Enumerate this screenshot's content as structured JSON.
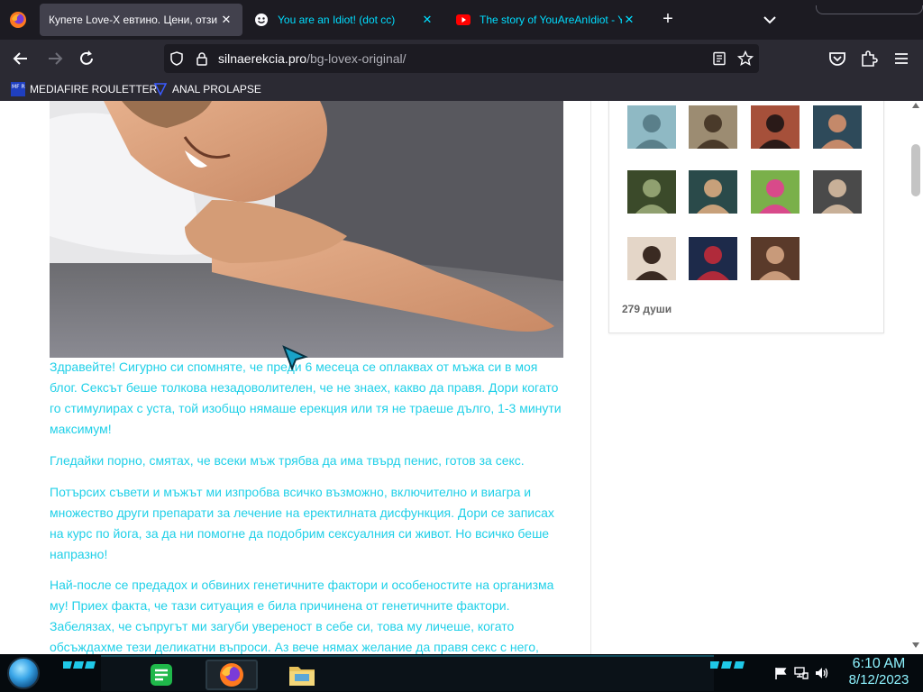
{
  "browser": {
    "tabs": [
      {
        "title": "Купете Love-X евтино. Цени, отзи",
        "active": true
      },
      {
        "title": "You are an Idiot! (dot cc)",
        "active": false
      },
      {
        "title": "The story of YouAreAnIdiot - Yo",
        "active": false
      }
    ],
    "url": {
      "domain": "silnaerekcia.pro",
      "path": "/bg-lovex-original/"
    },
    "bookmarks": [
      {
        "label": "MEDIAFIRE ROULETTER",
        "icon_text": "MF R"
      },
      {
        "label": "ANAL PROLAPSE"
      }
    ]
  },
  "article": {
    "paragraphs": [
      "Здравейте! Сигурно си спомняте, че преди 6 месеца се оплаквах от мъжа си в моя блог. Сексът беше толкова незадоволителен, че не знаех, какво да правя. Дори когато го стимулирах с уста, той изобщо нямаше ерекция или тя не траеше дълго, 1-3 минути максимум!",
      "Гледайки порно, смятах, че всеки мъж трябва да има твърд пенис, готов за секс.",
      "Потърсих съвети и мъжът ми изпробва всичко възможно, включително и виагра и множество други препарати за лечение на еректилната дисфункция. Дори се записах на курс по йога, за да ни помогне да подобрим сексуалния си живот. Но всичко беше напразно!",
      "Най-после се предадох и обвиних генетичните фактори и особеностите на организма му! Приех факта, че тази ситуация е била причинена от генетичните фактори. Забелязах, че съпругът ми загуби увереност в себе си, това му личеше, когато обсъждахме тези деликатни въпроси. Аз вече нямах желание да правя секс с него,"
    ],
    "text_color": "#20d0e8"
  },
  "sidebar": {
    "avatars": [
      "cartoon-scientist",
      "man-with-glasses",
      "woman-red-hair",
      "woman-dark-hair",
      "masked-figure",
      "man-sunglasses",
      "joker-face",
      "bearded-cartoon-man",
      "girl-sketch",
      "woman-blue-jacket",
      "woman-portrait"
    ],
    "souls_count": "279 души"
  },
  "taskbar": {
    "apps": [
      "notes-app",
      "firefox",
      "file-explorer"
    ],
    "clock": {
      "time": "6:10 AM",
      "date": "8/12/2023"
    }
  }
}
